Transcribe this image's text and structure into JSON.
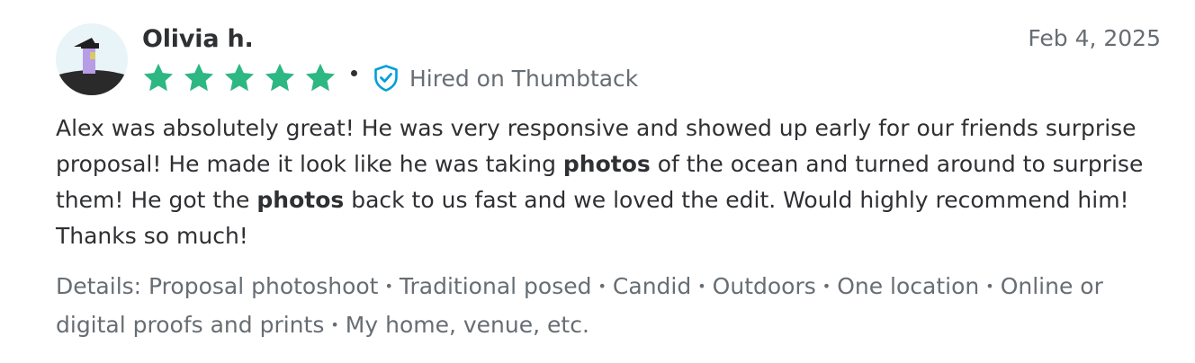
{
  "review": {
    "reviewer_name": "Olivia h.",
    "date": "Feb 4, 2025",
    "rating": 5,
    "rating_max": 5,
    "hired_label": "Hired on Thumbtack",
    "body_segments": [
      {
        "text": "Alex was absolutely great! He was very responsive and showed up early for our friends surprise proposal! He made it look like he was taking ",
        "bold": false
      },
      {
        "text": "photos",
        "bold": true
      },
      {
        "text": " of the ocean and turned around to surprise them! He got the ",
        "bold": false
      },
      {
        "text": "photos",
        "bold": true
      },
      {
        "text": " back to us fast and we loved the edit. Would highly recommend him! Thanks so much!",
        "bold": false
      }
    ],
    "details_prefix": "Details:",
    "details": [
      "Proposal photoshoot",
      "Traditional posed",
      "Candid",
      "Outdoors",
      "One location",
      "Online or digital proofs and prints",
      "My home, venue, etc."
    ]
  },
  "colors": {
    "star": "#2db783",
    "verified": "#009fd9",
    "text": "#2f3033",
    "muted": "#676d73"
  },
  "icons": {
    "avatar": "avatar",
    "star": "star-icon",
    "verified": "verified-shield-icon"
  }
}
